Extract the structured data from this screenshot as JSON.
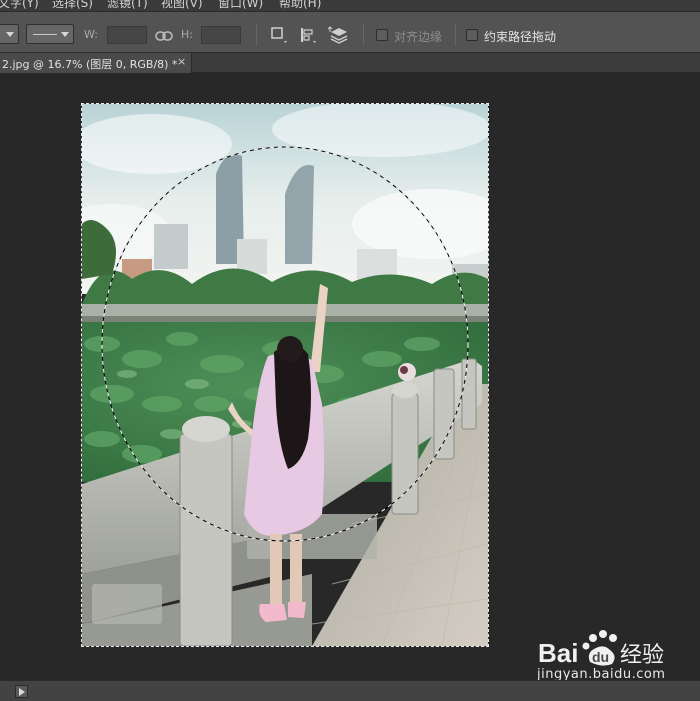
{
  "menu": {
    "items": [
      {
        "label": "文字(Y)",
        "key": "type"
      },
      {
        "label": "选择(S)",
        "key": "select"
      },
      {
        "label": "滤镜(T)",
        "key": "filter"
      },
      {
        "label": "视图(V)",
        "key": "view"
      },
      {
        "label": "窗口(W)",
        "key": "window"
      },
      {
        "label": "帮助(H)",
        "key": "help"
      }
    ]
  },
  "options": {
    "width_label": "W:",
    "height_label": "H:",
    "width_value": "",
    "height_value": "",
    "align_edges_label": "对齐边缘",
    "constrain_path_label": "约束路径拖动",
    "align_edges_checked": false,
    "constrain_path_checked": false
  },
  "document": {
    "tab_title": "2.jpg @ 16.7% (图层 0, RGB/8) *",
    "close_glyph": "×",
    "zoom": "16.7%",
    "layer": "图层 0",
    "color_mode": "RGB/8"
  },
  "watermark": {
    "logo_text": "Bai",
    "logo_text_2": "du",
    "logo_text_3": "经验",
    "url": "jingyan.baidu.com"
  },
  "colors": {
    "background": "#282828",
    "panel": "#535353",
    "menu": "#3a3a3a",
    "marching_ants": "#ffffff"
  }
}
